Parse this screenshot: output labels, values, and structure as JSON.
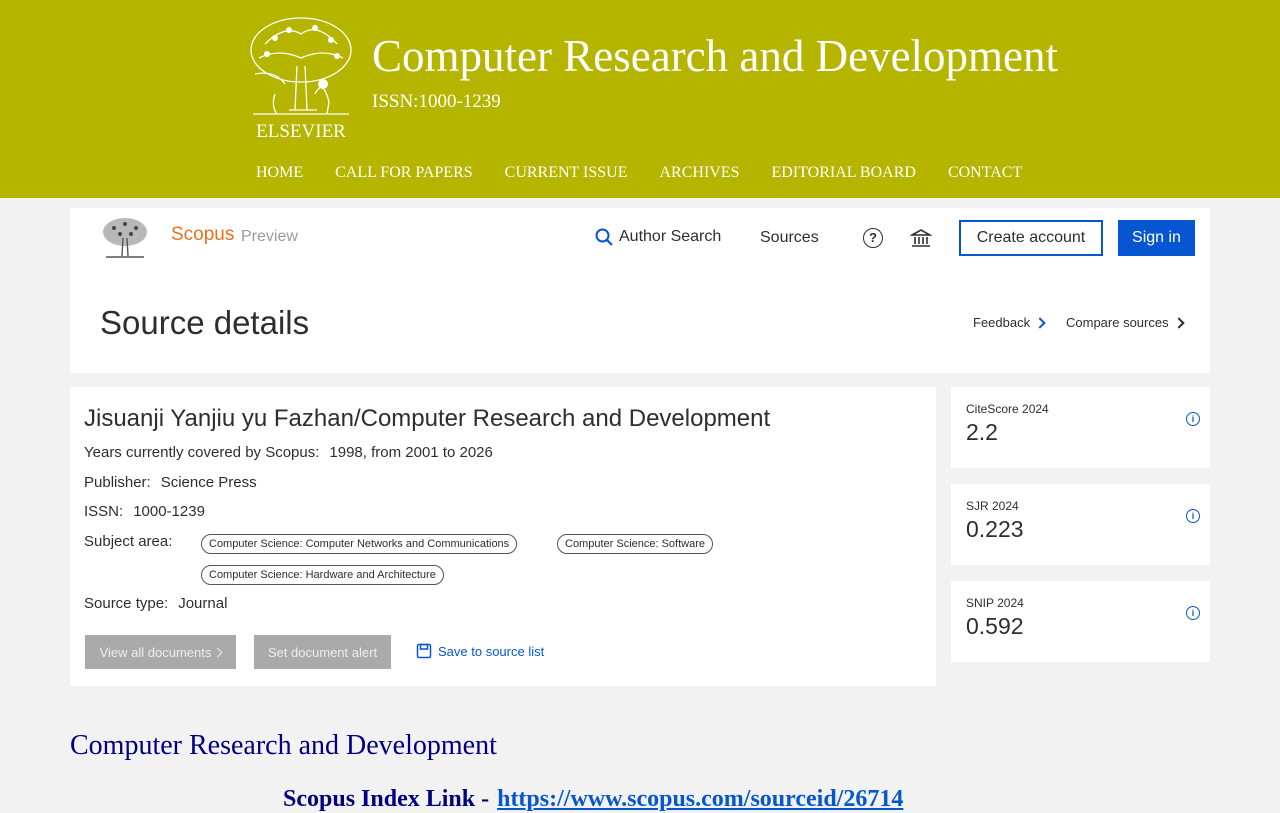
{
  "site": {
    "logo_word": "ELSEVIER",
    "title": "Computer Research and Development",
    "issn": "ISSN:1000-1239",
    "nav": [
      "HOME",
      "CALL FOR PAPERS",
      "CURRENT ISSUE",
      "ARCHIVES",
      "EDITORIAL BOARD",
      "CONTACT"
    ],
    "bg_color": "#b5b500"
  },
  "scopus": {
    "brand": "Scopus",
    "preview": "Preview",
    "author_search": "Author Search",
    "sources": "Sources",
    "create_account": "Create account",
    "sign_in": "Sign in",
    "page_title": "Source details",
    "feedback": "Feedback",
    "compare_sources": "Compare sources",
    "accent_color": "#0656d2",
    "brand_color": "#e9711c"
  },
  "journal": {
    "title": "Jisuanji Yanjiu yu Fazhan/Computer Research and Development",
    "years_label": "Years currently covered by Scopus:",
    "years_value": "1998, from 2001 to 2026",
    "publisher_label": "Publisher:",
    "publisher_value": "Science Press",
    "issn_label": "ISSN:",
    "issn_value": "1000-1239",
    "subject_label": "Subject area:",
    "subjects": [
      "Computer Science: Computer Networks and Communications",
      "Computer Science: Software",
      "Computer Science: Hardware and Architecture"
    ],
    "source_type_label": "Source type:",
    "source_type_value": "Journal",
    "view_all": "View all documents",
    "set_alert": "Set document alert",
    "save_to_list": "Save to source list"
  },
  "metrics": [
    {
      "label": "CiteScore 2024",
      "value": "2.2"
    },
    {
      "label": "SJR 2024",
      "value": "0.223"
    },
    {
      "label": "SNIP 2024",
      "value": "0.592"
    }
  ],
  "footer": {
    "title": "Computer Research and Development",
    "index_label": "Scopus Index Link -",
    "index_url": "https://www.scopus.com/sourceid/26714"
  }
}
